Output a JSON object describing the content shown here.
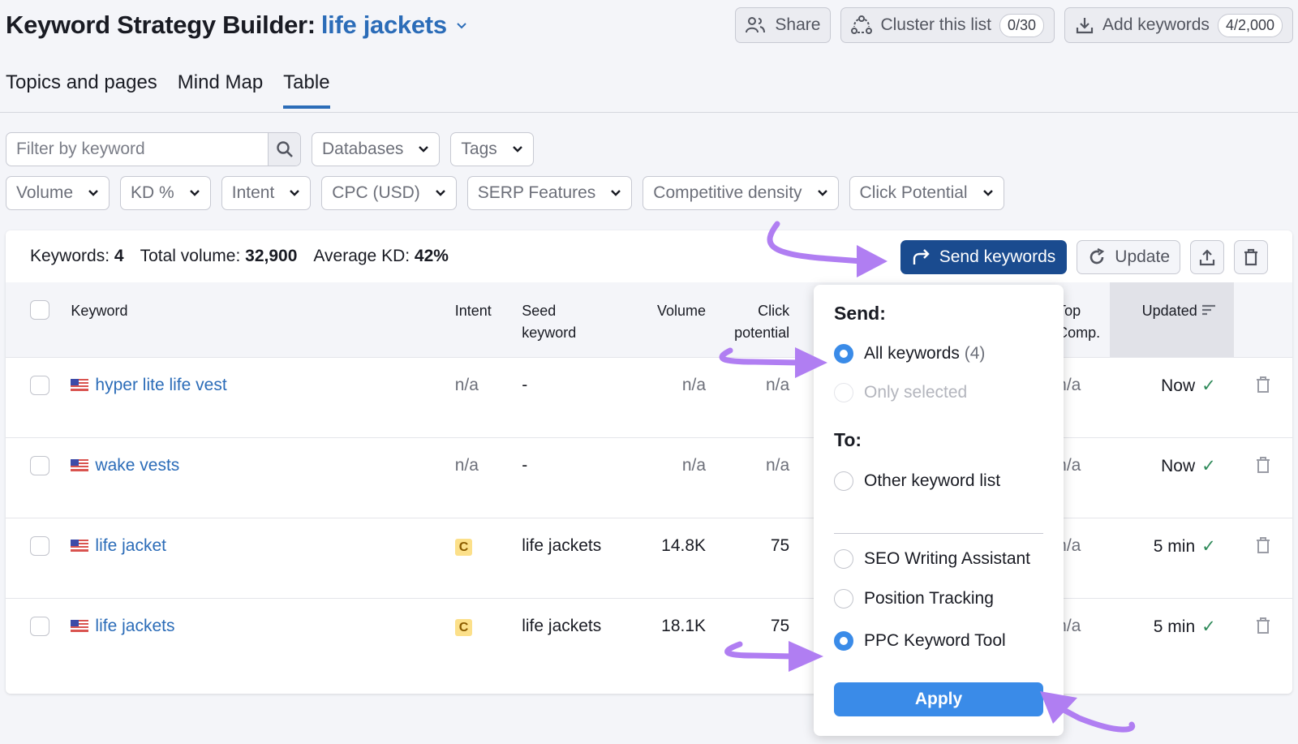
{
  "header": {
    "title_prefix": "Keyword Strategy Builder:",
    "project_name": "life jackets",
    "share_label": "Share",
    "cluster_label": "Cluster this list",
    "cluster_count": "0/30",
    "add_keywords_label": "Add keywords",
    "add_keywords_count": "4/2,000"
  },
  "tabs": [
    {
      "label": "Topics and pages",
      "active": false
    },
    {
      "label": "Mind Map",
      "active": false
    },
    {
      "label": "Table",
      "active": true
    }
  ],
  "filters": {
    "search_placeholder": "Filter by keyword",
    "search_value": "",
    "row1": [
      "Databases",
      "Tags"
    ],
    "row2": [
      "Volume",
      "KD %",
      "Intent",
      "CPC (USD)",
      "SERP Features",
      "Competitive density",
      "Click Potential"
    ]
  },
  "summary": {
    "keywords_label": "Keywords:",
    "keywords_value": "4",
    "volume_label": "Total volume:",
    "volume_value": "32,900",
    "kd_label": "Average KD:",
    "kd_value": "42%"
  },
  "toolbar": {
    "send_label": "Send keywords",
    "update_label": "Update"
  },
  "table": {
    "columns": {
      "keyword": "Keyword",
      "intent": "Intent",
      "seed_l1": "Seed",
      "seed_l2": "keyword",
      "volume": "Volume",
      "click_l1": "Click",
      "click_l2": "potential",
      "topcomp_l1": "Top",
      "topcomp_l2": "Comp.",
      "updated": "Updated"
    },
    "rows": [
      {
        "keyword": "hyper lite life vest",
        "intent": "n/a",
        "seed": "-",
        "volume": "n/a",
        "click": "n/a",
        "top_comp": "n/a",
        "updated": "Now"
      },
      {
        "keyword": "wake vests",
        "intent": "n/a",
        "seed": "-",
        "volume": "n/a",
        "click": "n/a",
        "top_comp": "n/a",
        "updated": "Now"
      },
      {
        "keyword": "life jacket",
        "intent": "C",
        "seed": "life jackets",
        "volume": "14.8K",
        "click": "75",
        "top_comp": "n/a",
        "updated": "5 min"
      },
      {
        "keyword": "life jackets",
        "intent": "C",
        "seed": "life jackets",
        "volume": "18.1K",
        "click": "75",
        "top_comp": "n/a",
        "updated": "5 min"
      }
    ]
  },
  "popup": {
    "send_heading": "Send:",
    "send_options": [
      {
        "label": "All keywords",
        "count": "(4)",
        "selected": true,
        "disabled": false
      },
      {
        "label": "Only selected",
        "count": "",
        "selected": false,
        "disabled": true
      }
    ],
    "to_heading": "To:",
    "to_options_top": [
      {
        "label": "Other keyword list",
        "selected": false
      }
    ],
    "to_options_tools": [
      {
        "label": "SEO Writing Assistant",
        "selected": false
      },
      {
        "label": "Position Tracking",
        "selected": false
      },
      {
        "label": "PPC Keyword Tool",
        "selected": true
      }
    ],
    "apply_label": "Apply"
  },
  "colors": {
    "brand_blue": "#2b6cb8",
    "primary_button": "#1a4b8f",
    "apply_button": "#3a8be8",
    "annotation_arrow": "#b07ef2",
    "intent_commercial": "#fce08a",
    "check_green": "#2f8a5a"
  }
}
